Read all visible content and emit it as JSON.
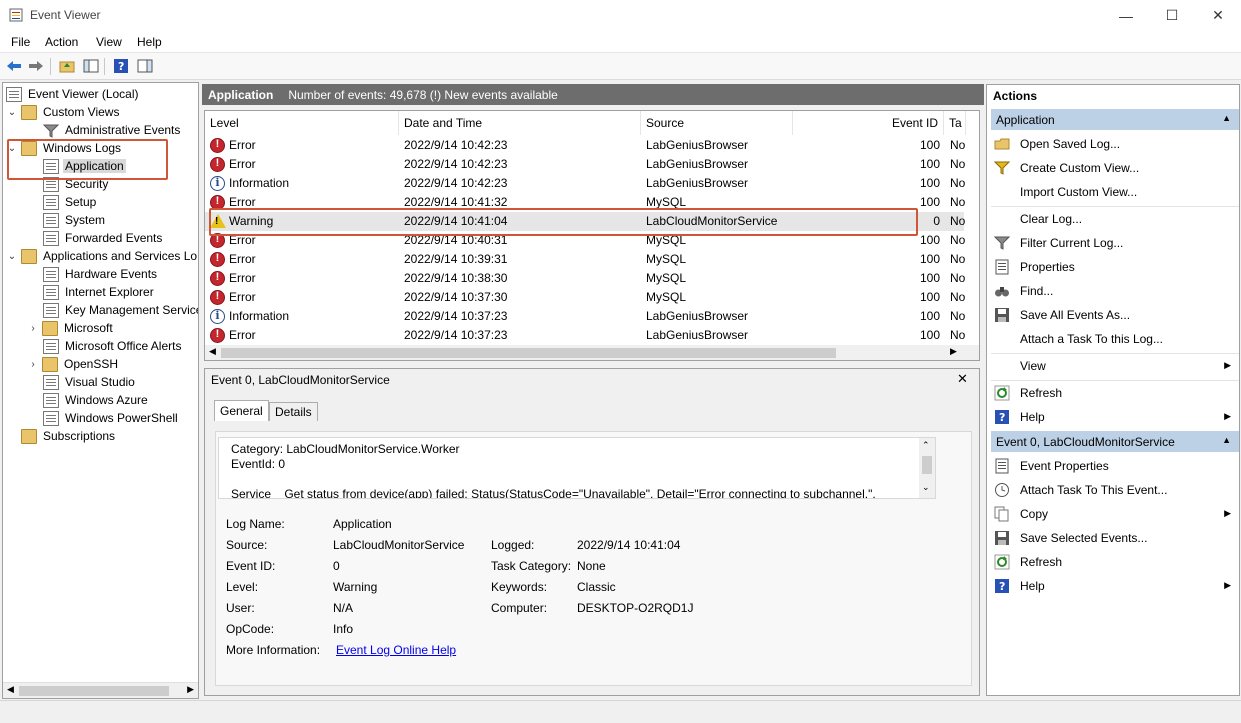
{
  "window": {
    "title": "Event Viewer",
    "minimize": "—",
    "maximize": "☐",
    "close": "✕"
  },
  "menu": [
    "File",
    "Action",
    "View",
    "Help"
  ],
  "tree": {
    "root": "Event Viewer (Local)",
    "custom_views": "Custom Views",
    "admin_events": "Administrative Events",
    "windows_logs": "Windows Logs",
    "application": "Application",
    "security": "Security",
    "setup": "Setup",
    "system": "System",
    "forwarded": "Forwarded Events",
    "apps_services": "Applications and Services Lo",
    "hardware": "Hardware Events",
    "ie": "Internet Explorer",
    "kms": "Key Management Service",
    "microsoft": "Microsoft",
    "office_alerts": "Microsoft Office Alerts",
    "openssh": "OpenSSH",
    "visual_studio": "Visual Studio",
    "azure": "Windows Azure",
    "powershell": "Windows PowerShell",
    "subscriptions": "Subscriptions"
  },
  "center": {
    "log_name": "Application",
    "count_text": "Number of events: 49,678 (!) New events available"
  },
  "columns": [
    "Level",
    "Date and Time",
    "Source",
    "Event ID",
    "Ta"
  ],
  "events": [
    {
      "level": "Error",
      "date": "2022/9/14 10:42:23",
      "source": "LabGeniusBrowser",
      "id": "100",
      "task": "No"
    },
    {
      "level": "Error",
      "date": "2022/9/14 10:42:23",
      "source": "LabGeniusBrowser",
      "id": "100",
      "task": "No"
    },
    {
      "level": "Information",
      "date": "2022/9/14 10:42:23",
      "source": "LabGeniusBrowser",
      "id": "100",
      "task": "No"
    },
    {
      "level": "Error",
      "date": "2022/9/14 10:41:32",
      "source": "MySQL",
      "id": "100",
      "task": "No"
    },
    {
      "level": "Warning",
      "date": "2022/9/14 10:41:04",
      "source": "LabCloudMonitorService",
      "id": "0",
      "task": "No"
    },
    {
      "level": "Error",
      "date": "2022/9/14 10:40:31",
      "source": "MySQL",
      "id": "100",
      "task": "No"
    },
    {
      "level": "Error",
      "date": "2022/9/14 10:39:31",
      "source": "MySQL",
      "id": "100",
      "task": "No"
    },
    {
      "level": "Error",
      "date": "2022/9/14 10:38:30",
      "source": "MySQL",
      "id": "100",
      "task": "No"
    },
    {
      "level": "Error",
      "date": "2022/9/14 10:37:30",
      "source": "MySQL",
      "id": "100",
      "task": "No"
    },
    {
      "level": "Information",
      "date": "2022/9/14 10:37:23",
      "source": "LabGeniusBrowser",
      "id": "100",
      "task": "No"
    },
    {
      "level": "Error",
      "date": "2022/9/14 10:37:23",
      "source": "LabGeniusBrowser",
      "id": "100",
      "task": "No"
    }
  ],
  "detail": {
    "title": "Event 0, LabCloudMonitorService",
    "close": "✕",
    "tab_general": "General",
    "tab_details": "Details",
    "desc_line1": "Category: LabCloudMonitorService.Worker",
    "desc_line2": "EventId: 0",
    "desc_line3": "Service    Get status from device(app) failed: Status(StatusCode=\"Unavailable\", Detail=\"Error connecting to subchannel.\",",
    "labels": {
      "log_name": "Log Name:",
      "source": "Source:",
      "event_id": "Event ID:",
      "level": "Level:",
      "user": "User:",
      "opcode": "OpCode:",
      "more_info": "More Information:",
      "logged": "Logged:",
      "task_category": "Task Category:",
      "keywords": "Keywords:",
      "computer": "Computer:"
    },
    "values": {
      "log_name": "Application",
      "source": "LabCloudMonitorService",
      "event_id": "0",
      "level": "Warning",
      "user": "N/A",
      "opcode": "Info",
      "more_info_link": "Event Log Online Help",
      "logged": "2022/9/14 10:41:04",
      "task_category": "None",
      "keywords": "Classic",
      "computer": "DESKTOP-O2RQD1J"
    }
  },
  "actions": {
    "title": "Actions",
    "section1": "Application",
    "items1": [
      {
        "label": "Open Saved Log...",
        "icon": "folder-open-icon"
      },
      {
        "label": "Create Custom View...",
        "icon": "filter-star-icon"
      },
      {
        "label": "Import Custom View...",
        "icon": ""
      },
      {
        "label": "Clear Log...",
        "icon": ""
      },
      {
        "label": "Filter Current Log...",
        "icon": "filter-icon"
      },
      {
        "label": "Properties",
        "icon": "properties-icon"
      },
      {
        "label": "Find...",
        "icon": "binoculars-icon"
      },
      {
        "label": "Save All Events As...",
        "icon": "save-icon"
      },
      {
        "label": "Attach a Task To this Log...",
        "icon": ""
      },
      {
        "label": "View",
        "icon": ""
      },
      {
        "label": "Refresh",
        "icon": "refresh-icon"
      },
      {
        "label": "Help",
        "icon": "help-icon"
      }
    ],
    "section2": "Event 0, LabCloudMonitorService",
    "items2": [
      {
        "label": "Event Properties",
        "icon": "properties-icon"
      },
      {
        "label": "Attach Task To This Event...",
        "icon": "clock-icon"
      },
      {
        "label": "Copy",
        "icon": "copy-icon"
      },
      {
        "label": "Save Selected Events...",
        "icon": "save-icon"
      },
      {
        "label": "Refresh",
        "icon": "refresh-icon"
      },
      {
        "label": "Help",
        "icon": "help-icon"
      }
    ]
  },
  "colors": {
    "accent_header": "#bcd0e6",
    "highlight_box": "#cf5638",
    "error": "#c4262e",
    "warning": "#e7c31a"
  }
}
